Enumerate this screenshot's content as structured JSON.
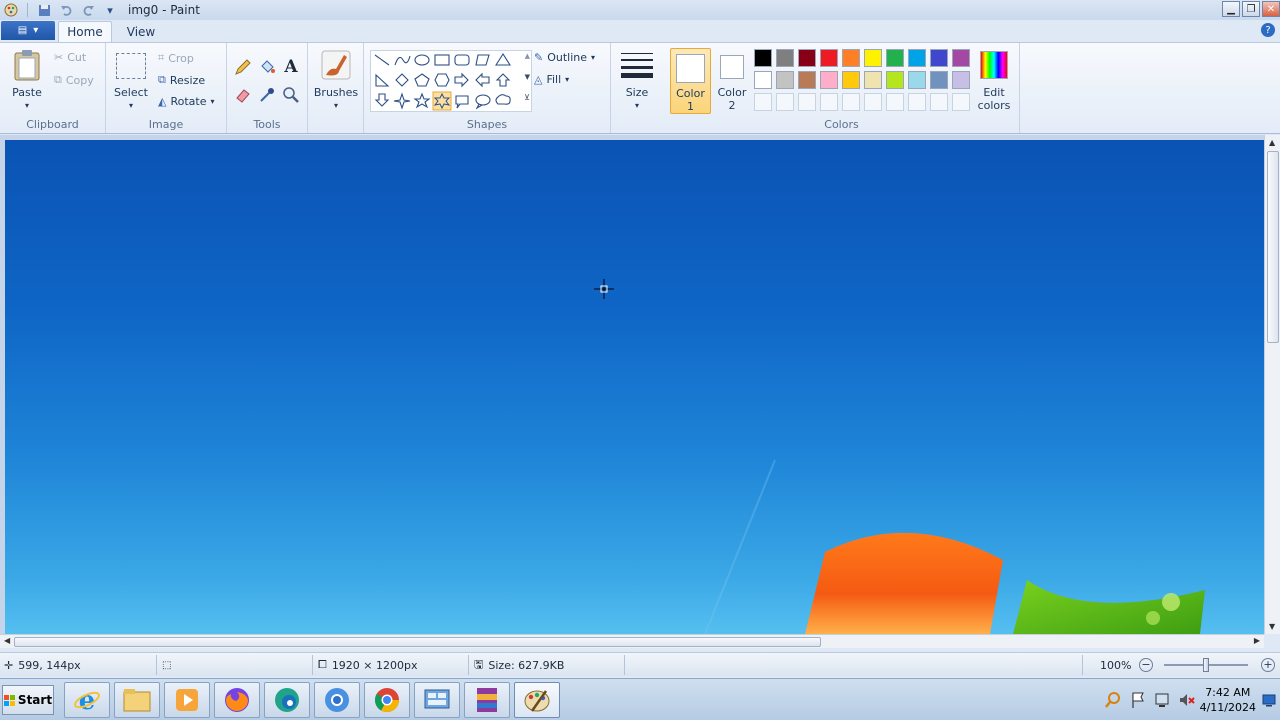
{
  "window": {
    "title": "img0 - Paint"
  },
  "tabs": [
    {
      "label": "Home",
      "active": true
    },
    {
      "label": "View",
      "active": false
    }
  ],
  "ribbon": {
    "clipboard": {
      "label": "Clipboard",
      "paste": "Paste",
      "cut": "Cut",
      "copy": "Copy"
    },
    "image": {
      "label": "Image",
      "select": "Select",
      "crop": "Crop",
      "resize": "Resize",
      "rotate": "Rotate"
    },
    "tools": {
      "label": "Tools"
    },
    "brushes": {
      "label": "Brushes"
    },
    "shapes": {
      "label": "Shapes",
      "outline": "Outline",
      "fill": "Fill"
    },
    "size": {
      "label": "Size"
    },
    "colors": {
      "label": "Colors",
      "color1_line1": "Color",
      "color1_line2": "1",
      "color2_line1": "Color",
      "color2_line2": "2",
      "edit_line1": "Edit",
      "edit_line2": "colors",
      "color1": "#ffffff",
      "color2": "#ffffff",
      "palette_row1": [
        "#000000",
        "#7f7f7f",
        "#880015",
        "#ed1c24",
        "#ff7f27",
        "#fff200",
        "#22b14c",
        "#00a2e8",
        "#3f48cc",
        "#a349a4"
      ],
      "palette_row2": [
        "#ffffff",
        "#c3c3c3",
        "#b97a57",
        "#ffaec9",
        "#ffc90e",
        "#efe4b0",
        "#b5e61d",
        "#99d9ea",
        "#7092be",
        "#c8bfe7"
      ]
    }
  },
  "status": {
    "cursor_pos": "599, 144px",
    "dimensions": "1920 × 1200px",
    "file_size": "Size: 627.9KB",
    "zoom": "100%"
  },
  "taskbar": {
    "start": "Start",
    "time": "7:42 AM",
    "date": "4/11/2024"
  }
}
